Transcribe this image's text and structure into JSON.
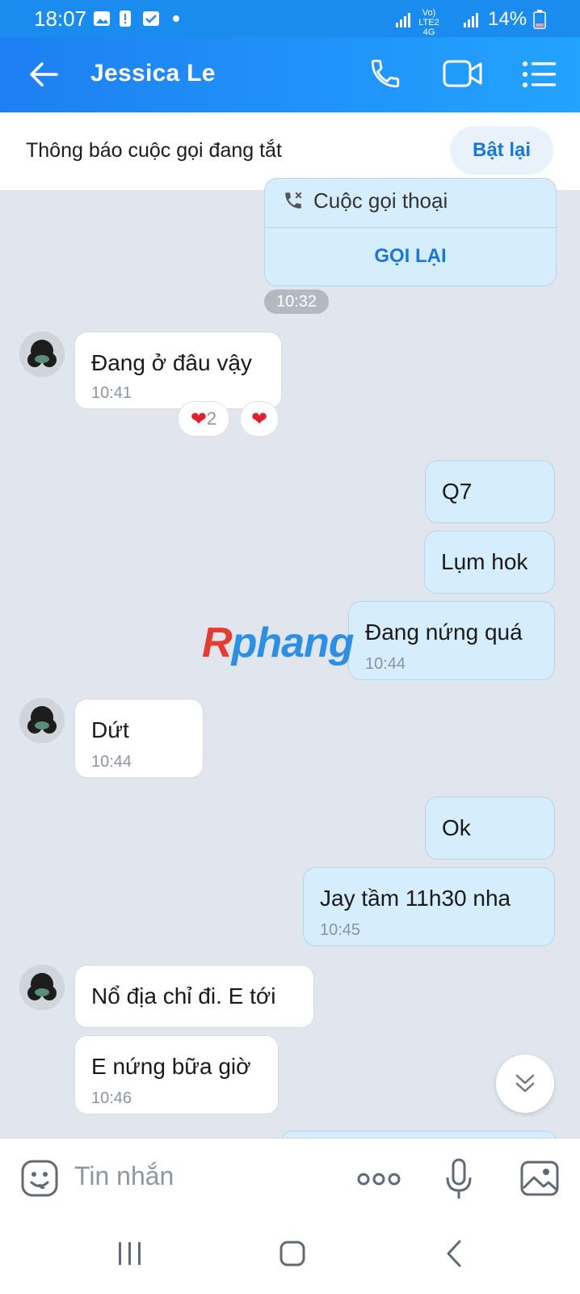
{
  "status_bar": {
    "time": "18:07",
    "network": "Vo) LTE2 4G",
    "battery": "14%"
  },
  "header": {
    "title": "Jessica Le",
    "back_icon": "back-arrow-icon",
    "call_icon": "phone-icon",
    "video_icon": "video-camera-icon",
    "menu_icon": "list-menu-icon"
  },
  "notice": {
    "text": "Thông báo cuộc gọi đang tắt",
    "button": "Bật lại"
  },
  "call_card": {
    "label": "Cuộc gọi thoại",
    "action": "GỌI LẠI"
  },
  "time_separator": "10:32",
  "messages": [
    {
      "side": "in",
      "text": "Đang ở đâu vậy",
      "time": "10:41"
    },
    {
      "side": "out",
      "text": "Q7",
      "time": ""
    },
    {
      "side": "out",
      "text": "Lụm hok",
      "time": ""
    },
    {
      "side": "out",
      "text": "Đang nứng quá",
      "time": "10:44"
    },
    {
      "side": "in",
      "text": "Dứt",
      "time": "10:44"
    },
    {
      "side": "out",
      "text": "Ok",
      "time": ""
    },
    {
      "side": "out",
      "text": "Jay tầm 11h30 nha",
      "time": "10:45"
    },
    {
      "side": "in",
      "text": "Nổ địa chỉ đi. E tới",
      "time": ""
    },
    {
      "side": "in",
      "text": "E nứng bữa giờ",
      "time": "10:46"
    }
  ],
  "reactions": {
    "count": "2"
  },
  "watermark": {
    "part1": "R",
    "part2": "phang"
  },
  "composer": {
    "placeholder": "Tin nhắn"
  }
}
